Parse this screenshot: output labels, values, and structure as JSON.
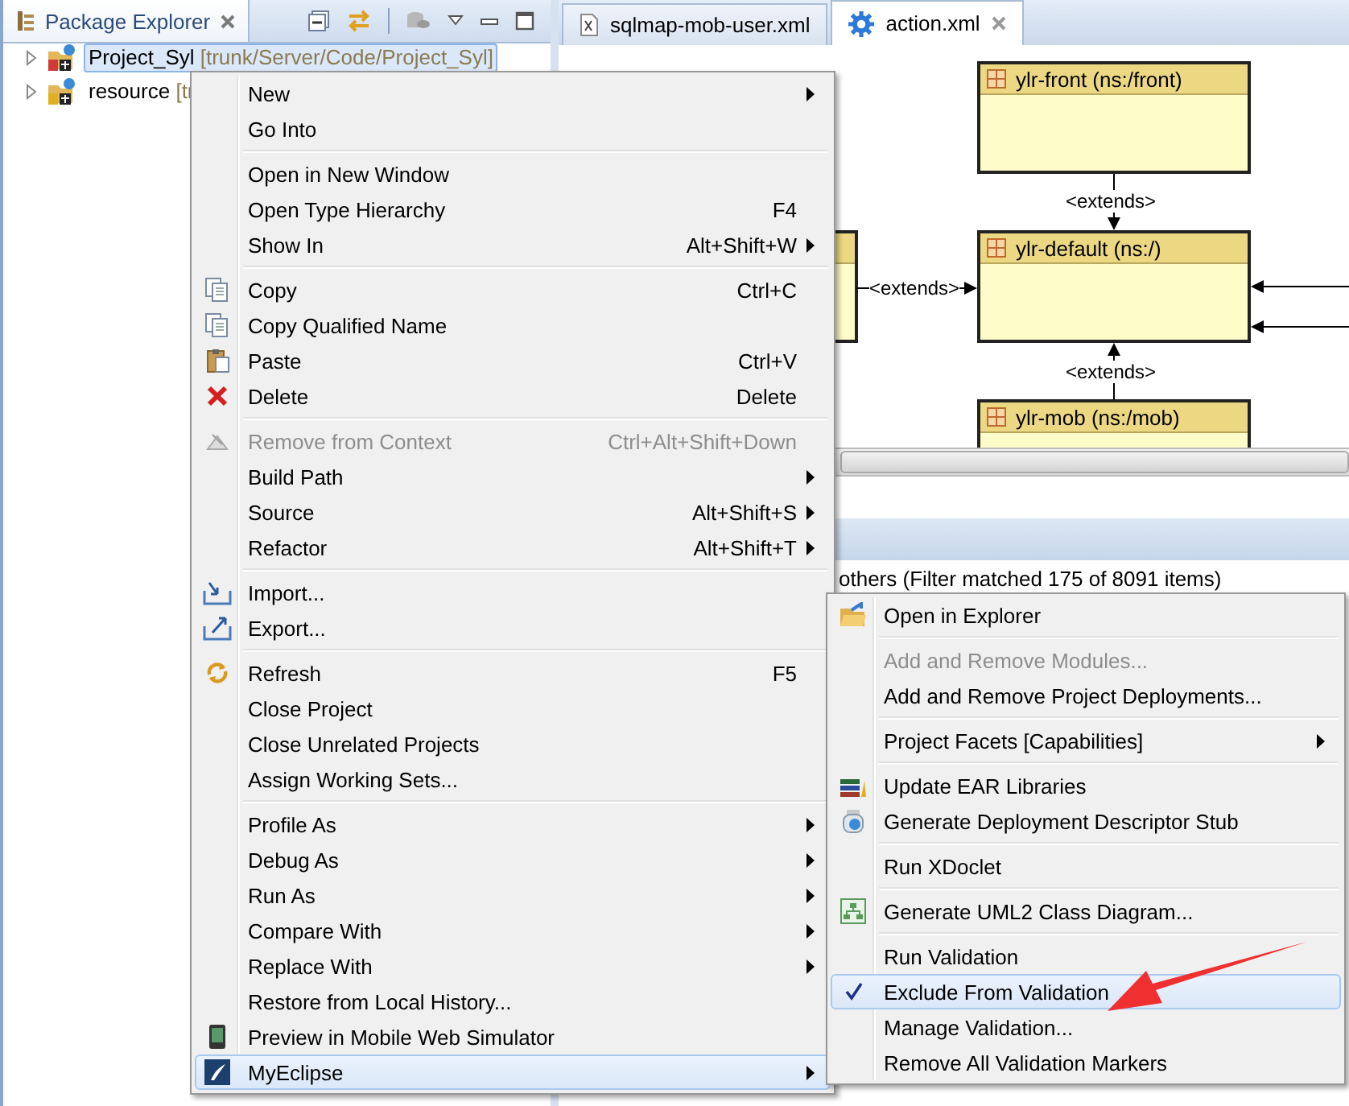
{
  "package_explorer": {
    "title": "Package Explorer",
    "tree": [
      {
        "label": "Project_Syl",
        "detail": "[trunk/Server/Code/Project_Syl]",
        "selected": true
      },
      {
        "label": "resource",
        "detail": "[tr",
        "selected": false
      }
    ]
  },
  "editor": {
    "tabs": [
      {
        "label": "sqlmap-mob-user.xml",
        "selected": false
      },
      {
        "label": "action.xml",
        "selected": true
      }
    ],
    "diagram": {
      "nodes": [
        {
          "title": "ylr-front (ns:/front)"
        },
        {
          "title": "ylr-default (ns:/)"
        },
        {
          "title": "ylr-mob (ns:/mob)"
        }
      ],
      "edges": [
        {
          "label": "<extends>"
        },
        {
          "label": "<extends>"
        },
        {
          "label": "<extends>"
        }
      ]
    },
    "filter_status": "others (Filter matched 175 of 8091 items)"
  },
  "context_menu": {
    "groups": [
      {
        "items": [
          {
            "label": "New",
            "submenu": true,
            "disabled": false,
            "selected": false
          },
          {
            "label": "Go Into",
            "submenu": false,
            "disabled": false,
            "selected": false
          }
        ]
      },
      {
        "items": [
          {
            "label": "Open in New Window",
            "submenu": false,
            "disabled": false,
            "selected": false
          },
          {
            "label": "Open Type Hierarchy",
            "shortcut": "F4",
            "submenu": false,
            "disabled": false,
            "selected": false
          },
          {
            "label": "Show In",
            "shortcut": "Alt+Shift+W",
            "submenu": true,
            "disabled": false,
            "selected": false
          }
        ]
      },
      {
        "items": [
          {
            "label": "Copy",
            "shortcut": "Ctrl+C",
            "kind": "copy",
            "submenu": false,
            "disabled": false,
            "selected": false
          },
          {
            "label": "Copy Qualified Name",
            "kind": "copy",
            "submenu": false,
            "disabled": false,
            "selected": false
          },
          {
            "label": "Paste",
            "shortcut": "Ctrl+V",
            "kind": "paste",
            "submenu": false,
            "disabled": false,
            "selected": false
          },
          {
            "label": "Delete",
            "shortcut": "Delete",
            "kind": "delete",
            "submenu": false,
            "disabled": false,
            "selected": false
          }
        ]
      },
      {
        "items": [
          {
            "label": "Remove from Context",
            "shortcut": "Ctrl+Alt+Shift+Down",
            "kind": "remove",
            "submenu": false,
            "disabled": true,
            "selected": false
          },
          {
            "label": "Build Path",
            "submenu": true,
            "disabled": false,
            "selected": false
          },
          {
            "label": "Source",
            "shortcut": "Alt+Shift+S",
            "submenu": true,
            "disabled": false,
            "selected": false
          },
          {
            "label": "Refactor",
            "shortcut": "Alt+Shift+T",
            "submenu": true,
            "disabled": false,
            "selected": false
          }
        ]
      },
      {
        "items": [
          {
            "label": "Import...",
            "kind": "import",
            "submenu": false,
            "disabled": false,
            "selected": false
          },
          {
            "label": "Export...",
            "kind": "export",
            "submenu": false,
            "disabled": false,
            "selected": false
          }
        ]
      },
      {
        "items": [
          {
            "label": "Refresh",
            "shortcut": "F5",
            "kind": "refresh",
            "submenu": false,
            "disabled": false,
            "selected": false
          },
          {
            "label": "Close Project",
            "submenu": false,
            "disabled": false,
            "selected": false
          },
          {
            "label": "Close Unrelated Projects",
            "submenu": false,
            "disabled": false,
            "selected": false
          },
          {
            "label": "Assign Working Sets...",
            "submenu": false,
            "disabled": false,
            "selected": false
          }
        ]
      },
      {
        "items": [
          {
            "label": "Profile As",
            "submenu": true,
            "disabled": false,
            "selected": false
          },
          {
            "label": "Debug As",
            "submenu": true,
            "disabled": false,
            "selected": false
          },
          {
            "label": "Run As",
            "submenu": true,
            "disabled": false,
            "selected": false
          },
          {
            "label": "Compare With",
            "submenu": true,
            "disabled": false,
            "selected": false
          },
          {
            "label": "Replace With",
            "submenu": true,
            "disabled": false,
            "selected": false
          },
          {
            "label": "Restore from Local History...",
            "submenu": false,
            "disabled": false,
            "selected": false
          },
          {
            "label": "Preview in Mobile Web Simulator",
            "kind": "phone",
            "submenu": false,
            "disabled": false,
            "selected": false
          },
          {
            "label": "MyEclipse",
            "kind": "myeclipse",
            "submenu": true,
            "disabled": false,
            "selected": true
          }
        ]
      }
    ]
  },
  "submenu": {
    "groups": [
      {
        "items": [
          {
            "label": "Open in Explorer",
            "kind": "folder",
            "submenu": false,
            "disabled": false,
            "selected": false,
            "checked": false
          }
        ]
      },
      {
        "items": [
          {
            "label": "Add and Remove Modules...",
            "submenu": false,
            "disabled": true,
            "selected": false,
            "checked": false
          },
          {
            "label": "Add and Remove Project Deployments...",
            "submenu": false,
            "disabled": false,
            "selected": false,
            "checked": false
          }
        ]
      },
      {
        "items": [
          {
            "label": "Project Facets [Capabilities]",
            "submenu": true,
            "disabled": false,
            "selected": false,
            "checked": false
          }
        ]
      },
      {
        "items": [
          {
            "label": "Update EAR Libraries",
            "kind": "books",
            "submenu": false,
            "disabled": false,
            "selected": false,
            "checked": false
          },
          {
            "label": "Generate Deployment Descriptor Stub",
            "kind": "jar",
            "submenu": false,
            "disabled": false,
            "selected": false,
            "checked": false
          }
        ]
      },
      {
        "items": [
          {
            "label": "Run XDoclet",
            "submenu": false,
            "disabled": false,
            "selected": false,
            "checked": false
          }
        ]
      },
      {
        "items": [
          {
            "label": "Generate UML2 Class Diagram...",
            "kind": "diagram",
            "submenu": false,
            "disabled": false,
            "selected": false,
            "checked": false
          }
        ]
      },
      {
        "items": [
          {
            "label": "Run Validation",
            "submenu": false,
            "disabled": false,
            "selected": false,
            "checked": false
          },
          {
            "label": "Exclude From Validation",
            "submenu": false,
            "disabled": false,
            "selected": true,
            "checked": true
          },
          {
            "label": "Manage Validation...",
            "submenu": false,
            "disabled": false,
            "selected": false,
            "checked": false
          },
          {
            "label": "Remove All Validation Markers",
            "submenu": false,
            "disabled": false,
            "selected": false,
            "checked": false
          }
        ]
      }
    ]
  }
}
